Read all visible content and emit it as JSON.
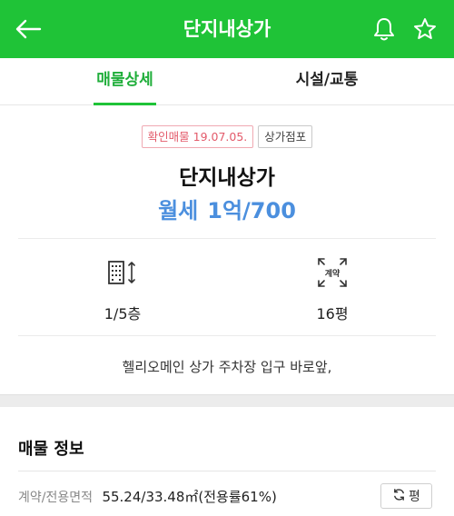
{
  "header": {
    "title": "단지내상가",
    "back_icon": "arrow-left-icon",
    "bell_icon": "bell-icon",
    "star_icon": "star-icon",
    "bg_color": "#1fc337"
  },
  "tabs": [
    {
      "label": "매물상세",
      "active": true
    },
    {
      "label": "시설/교통",
      "active": false
    }
  ],
  "listing": {
    "confirm_badge": "확인매물 19.07.05.",
    "type_badge": "상가점포",
    "name": "단지내상가",
    "price_label": "월세",
    "price_value": "1억/700",
    "price_color": "#4b8fde"
  },
  "stats": {
    "floors": "1/5층",
    "floors_icon": "building-floors-icon",
    "area": "16평",
    "area_icon": "contract-area-icon",
    "area_icon_text": "계약"
  },
  "description": "헬리오메인 상가 주차장 입구 바로앞,",
  "info": {
    "section_title": "매물 정보",
    "area_key": "계약/전용면적",
    "area_value": "55.24/33.48㎡(전용률61%)",
    "unit_button": "평",
    "unit_icon": "refresh-icon"
  }
}
